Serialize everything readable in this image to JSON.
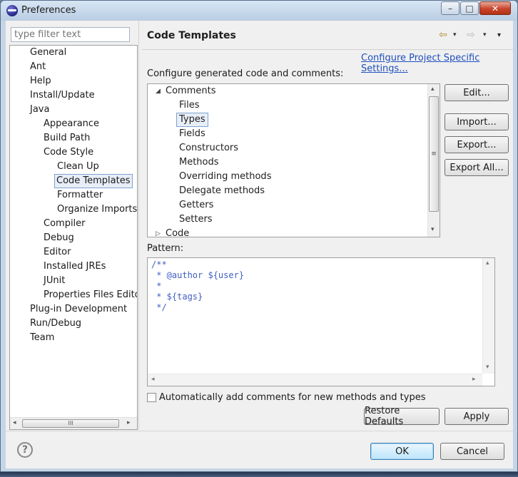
{
  "window": {
    "title": "Preferences",
    "minimize_glyph": "–",
    "maximize_glyph": "□",
    "close_glyph": "✕"
  },
  "sidebar": {
    "filter_placeholder": "type filter text",
    "items": [
      {
        "label": "General"
      },
      {
        "label": "Ant"
      },
      {
        "label": "Help"
      },
      {
        "label": "Install/Update"
      },
      {
        "label": "Java"
      },
      {
        "label": "Appearance"
      },
      {
        "label": "Build Path"
      },
      {
        "label": "Code Style"
      },
      {
        "label": "Clean Up"
      },
      {
        "label": "Code Templates",
        "selected": true
      },
      {
        "label": "Formatter"
      },
      {
        "label": "Organize Imports"
      },
      {
        "label": "Compiler"
      },
      {
        "label": "Debug"
      },
      {
        "label": "Editor"
      },
      {
        "label": "Installed JREs"
      },
      {
        "label": "JUnit"
      },
      {
        "label": "Properties Files Edito"
      },
      {
        "label": "Plug-in Development"
      },
      {
        "label": "Run/Debug"
      },
      {
        "label": "Team"
      }
    ],
    "scrollbar": {
      "left": "◂",
      "right": "▸",
      "grip": "III"
    }
  },
  "page": {
    "title": "Code Templates",
    "nav": {
      "back": "⇦",
      "forward": "⇨",
      "menu": "▾"
    },
    "configure_link": "Configure Project Specific Settings...",
    "configure_label": "Configure generated code and comments:",
    "templates": [
      {
        "label": "Comments",
        "expander": "◢"
      },
      {
        "label": "Files"
      },
      {
        "label": "Types",
        "selected": true
      },
      {
        "label": "Fields"
      },
      {
        "label": "Constructors"
      },
      {
        "label": "Methods"
      },
      {
        "label": "Overriding methods"
      },
      {
        "label": "Delegate methods"
      },
      {
        "label": "Getters"
      },
      {
        "label": "Setters"
      },
      {
        "label": "Code",
        "expander": "▷"
      }
    ],
    "list_scroll": {
      "up": "▴",
      "down": "▾",
      "grip": "≡"
    },
    "side_buttons": {
      "edit": "Edit...",
      "import": "Import...",
      "export": "Export...",
      "export_all": "Export All..."
    },
    "pattern_label": "Pattern:",
    "pattern_lines": [
      "/**",
      " * @author ${user}",
      " *",
      " * ${tags}",
      " */"
    ],
    "pattern_scroll": {
      "up": "▴",
      "down": "▾",
      "left": "◂",
      "right": "▸"
    },
    "auto_comments_label": "Automatically add comments for new methods and types",
    "auto_comments_checked": false,
    "restore_defaults": "Restore Defaults",
    "apply": "Apply"
  },
  "footer": {
    "help_glyph": "?",
    "ok": "OK",
    "cancel": "Cancel"
  }
}
